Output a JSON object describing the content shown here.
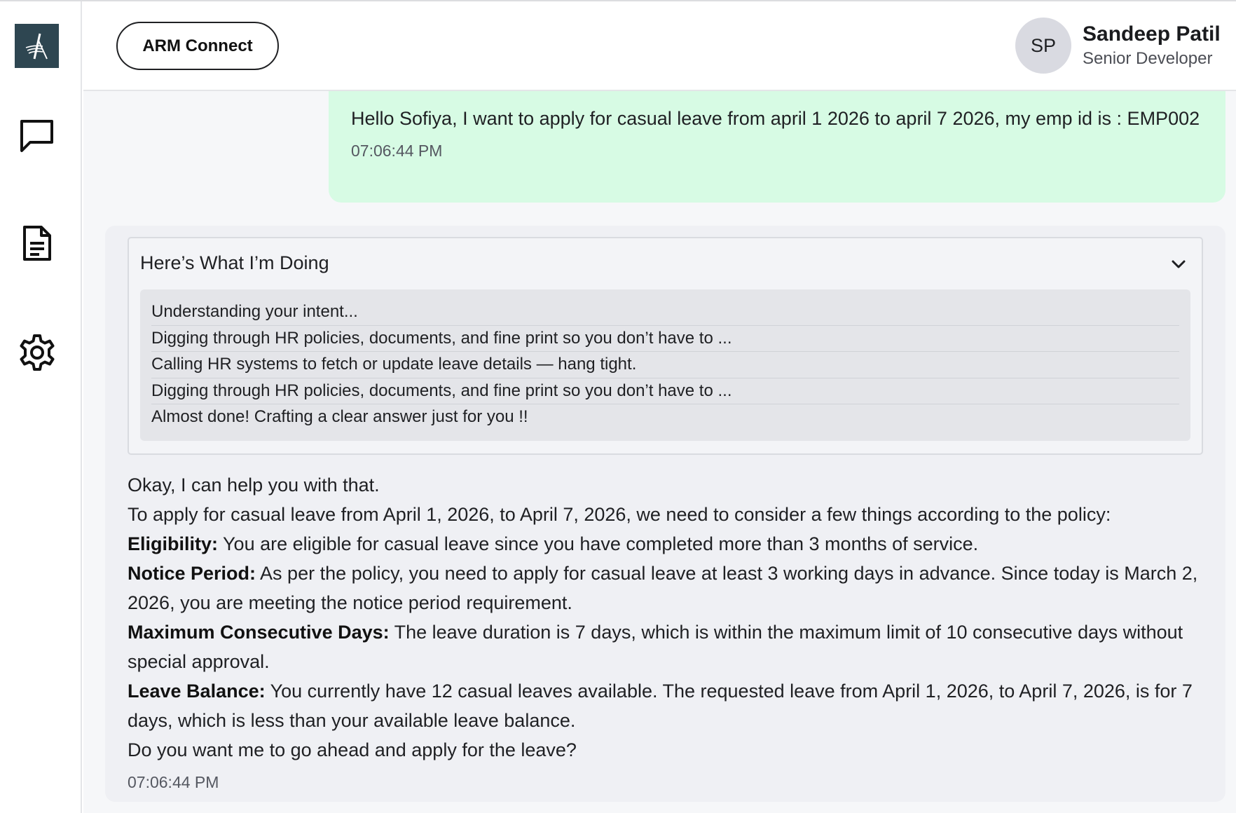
{
  "app": {
    "brand_label": "ARM Connect",
    "colors": {
      "logo_bg": "#2e4651",
      "user_bubble": "#d7fbe4",
      "bot_bubble": "#eff0f4"
    }
  },
  "sidebar": {
    "items": [
      {
        "name": "logo-icon"
      },
      {
        "name": "chat-icon"
      },
      {
        "name": "document-icon"
      },
      {
        "name": "settings-icon"
      }
    ]
  },
  "user": {
    "initials": "SP",
    "name": "Sandeep Patil",
    "role": "Senior Developer"
  },
  "messages": {
    "user_message": {
      "text": "Hello Sofiya, I want to apply for casual leave from april 1 2026 to april 7 2026, my emp id is : EMP002",
      "time": "07:06:44 PM"
    },
    "bot_message": {
      "thinking_title": "Here’s What I’m Doing",
      "steps": [
        "Understanding your intent...",
        "Digging through HR policies, documents, and fine print so you don’t have to ...",
        "Calling HR systems to fetch or update leave details — hang tight.",
        "Digging through HR policies, documents, and fine print so you don’t have to ...",
        "Almost done! Crafting a clear answer just for you !!"
      ],
      "intro": "Okay, I can help you with that.",
      "lead": "To apply for casual leave from April 1, 2026, to April 7, 2026, we need to consider a few things according to the policy:",
      "points": [
        {
          "label": "Eligibility:",
          "text": " You are eligible for casual leave since you have completed more than 3 months of service."
        },
        {
          "label": "Notice Period:",
          "text": " As per the policy, you need to apply for casual leave at least 3 working days in advance. Since today is March 2, 2026, you are meeting the notice period requirement."
        },
        {
          "label": "Maximum Consecutive Days:",
          "text": " The leave duration is 7 days, which is within the maximum limit of 10 consecutive days without special approval."
        },
        {
          "label": "Leave Balance:",
          "text": " You currently have 12 casual leaves available. The requested leave from April 1, 2026, to April 7, 2026, is for 7 days, which is less than your available leave balance."
        }
      ],
      "question": "Do you want me to go ahead and apply for the leave?",
      "time": "07:06:44 PM"
    }
  }
}
